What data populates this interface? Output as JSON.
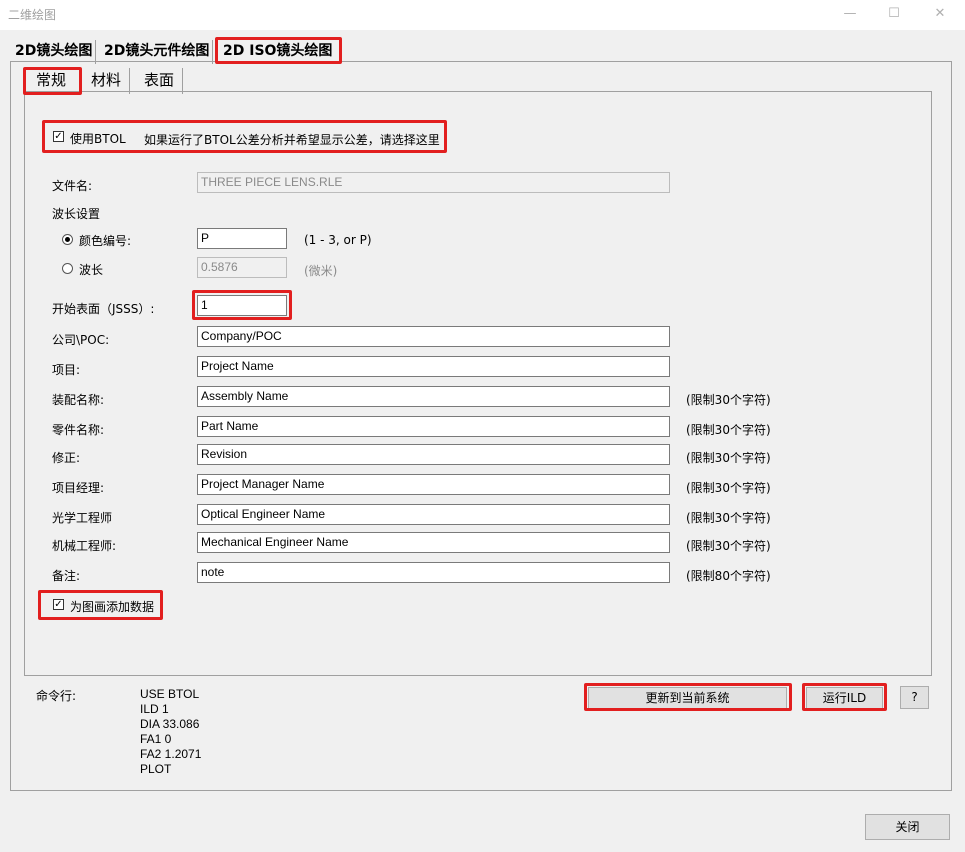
{
  "window": {
    "title": "二维绘图",
    "minimize_glyph": "—",
    "maximize_glyph": "☐",
    "close_glyph": "✕"
  },
  "tabs": [
    "2D镜头绘图",
    "2D镜头元件绘图",
    "2D ISO镜头绘图"
  ],
  "subtabs": [
    "常规",
    "材料",
    "表面"
  ],
  "btol": {
    "checked": true,
    "label": "使用BTOL",
    "description": "如果运行了BTOL公差分析并希望显示公差，请选择这里"
  },
  "filename": {
    "label": "文件名:",
    "value": "THREE PIECE LENS.RLE"
  },
  "wavelength": {
    "group_label": "波长设置",
    "color_label": "颜色编号:",
    "color_value": "P",
    "color_hint": "(1 - 3, or P)",
    "wave_label": "波长",
    "wave_value": "0.5876",
    "wave_hint": "(微米)",
    "selected": "color"
  },
  "start_surface": {
    "label": "开始表面（JSSS）:",
    "value": "1"
  },
  "fields": [
    {
      "label": "公司\\POC:",
      "value": "Company/POC",
      "limit": ""
    },
    {
      "label": "项目:",
      "value": "Project Name",
      "limit": ""
    },
    {
      "label": "装配名称:",
      "value": "Assembly Name",
      "limit": "(限制30个字符)"
    },
    {
      "label": "零件名称:",
      "value": "Part Name",
      "limit": "(限制30个字符)"
    },
    {
      "label": "修正:",
      "value": "Revision",
      "limit": "(限制30个字符)"
    },
    {
      "label": "项目经理:",
      "value": "Project Manager Name",
      "limit": "(限制30个字符)"
    },
    {
      "label": "光学工程师",
      "value": "Optical Engineer Name",
      "limit": "(限制30个字符)"
    },
    {
      "label": "机械工程师:",
      "value": "Mechanical Engineer Name",
      "limit": "(限制30个字符)"
    },
    {
      "label": "备注:",
      "value": "note",
      "limit": "(限制80个字符)"
    }
  ],
  "add_data": {
    "checked": true,
    "label": "为图画添加数据"
  },
  "command": {
    "label": "命令行:",
    "lines": [
      "USE BTOL",
      "ILD 1",
      "DIA 33.086",
      "FA1 0",
      "FA2 1.2071",
      "PLOT"
    ]
  },
  "buttons": {
    "update": "更新到当前系统",
    "run": "运行ILD",
    "help": "?",
    "close": "关闭"
  },
  "colors": {
    "highlight": "#e21f1f"
  }
}
